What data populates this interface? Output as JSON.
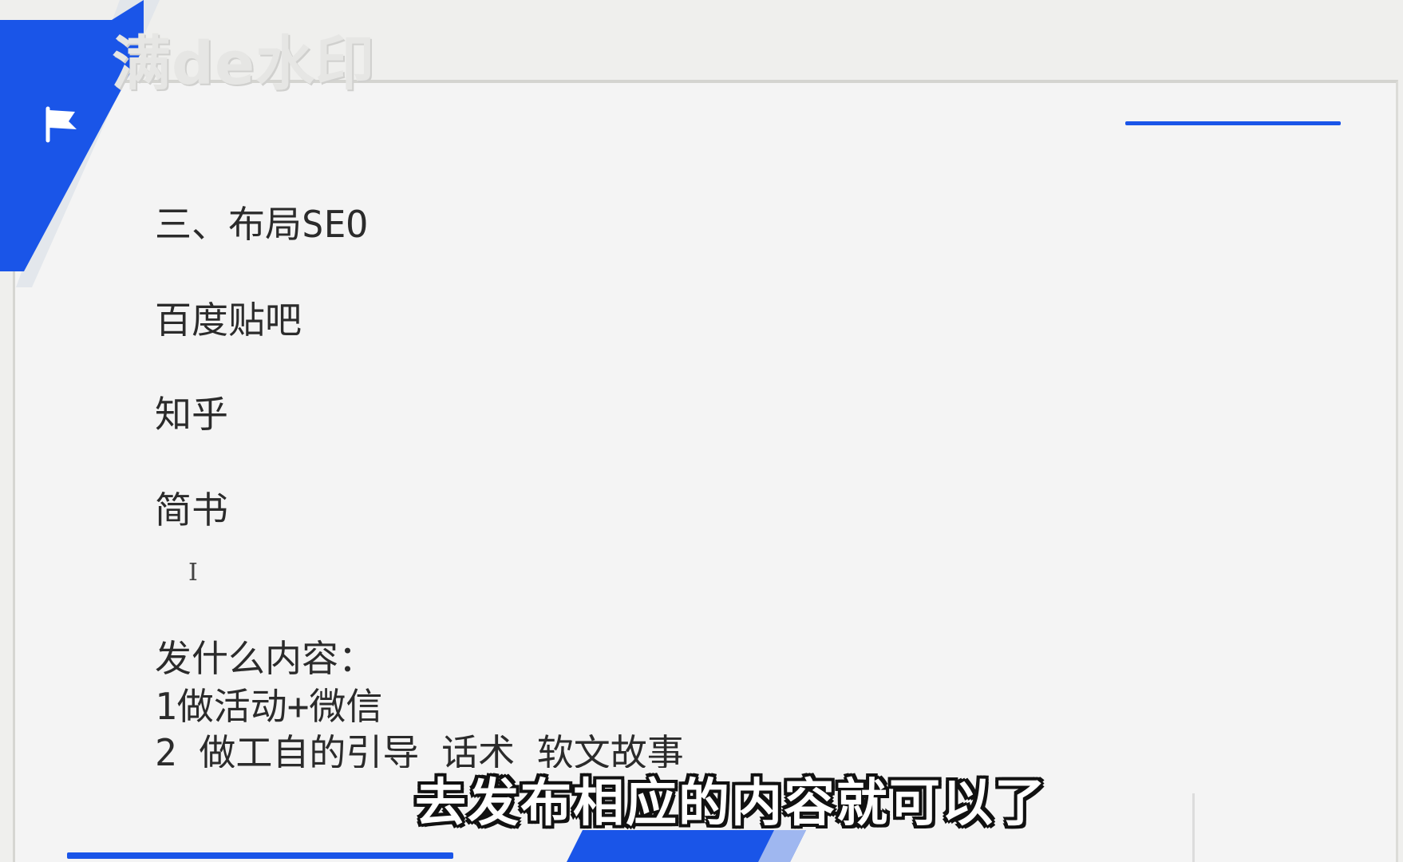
{
  "watermark": {
    "text": "满de水印"
  },
  "slide": {
    "lines": [
      "三、布局SEO",
      "百度贴吧",
      "知乎",
      "简书",
      "发什么内容：",
      "1做活动+微信",
      "2 做工自的引导  话术  软文故事"
    ]
  },
  "cursor": {
    "glyph": "I"
  },
  "subtitle": {
    "text": "去发布相应的内容就可以了"
  },
  "colors": {
    "accent": "#1a55e8",
    "slide_bg": "#f4f4f4",
    "text": "#2b2b2b"
  },
  "icons": [
    "flag-icon",
    "text-cursor-icon"
  ]
}
